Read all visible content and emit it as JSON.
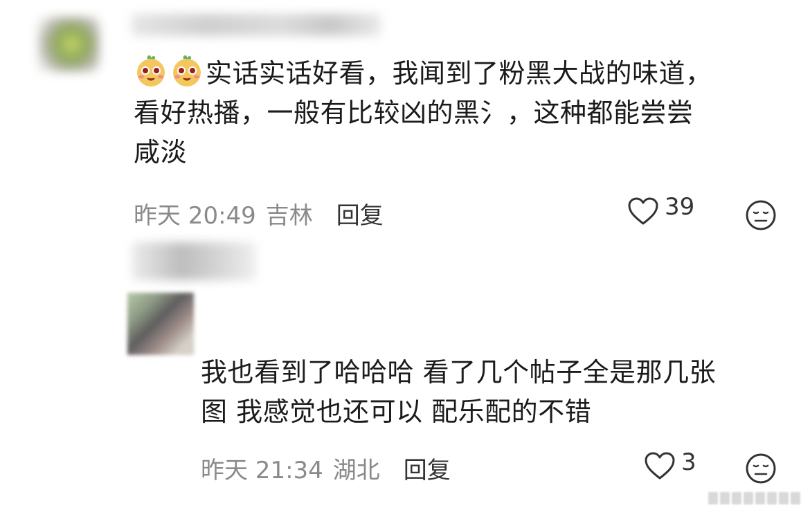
{
  "comments": [
    {
      "emoji_icon": "puppy-face-emoji-icon",
      "text_line1": "实话实话好看，我闻到了粉黑大战的味道，",
      "text_line2": "看好热播，一般有比较凶的黑氵，这种都能尝尝",
      "text_line3": "咸淡",
      "time": "昨天 20:49",
      "location": "吉林",
      "reply_label": "回复",
      "likes": "39"
    },
    {
      "text_line1": "我也看到了哈哈哈 看了几个帖子全是那几张",
      "text_line2": "图 我感觉也还可以 配乐配的不错",
      "time": "昨天 21:34",
      "location": "湖北",
      "reply_label": "回复",
      "likes": "3"
    }
  ],
  "colors": {
    "text": "#1b1b1b",
    "meta": "#8a8a8a",
    "icon": "#333333"
  }
}
